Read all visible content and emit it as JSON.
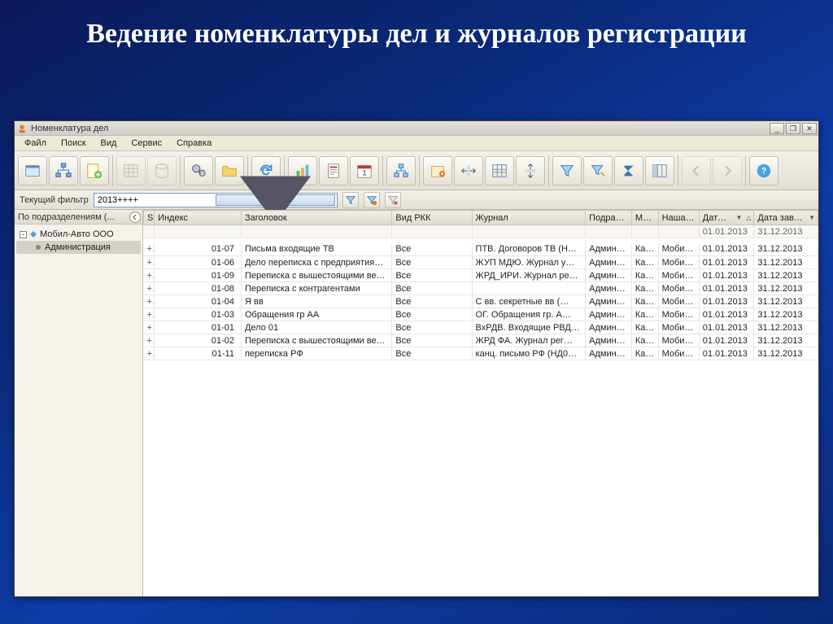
{
  "slide": {
    "title": "Ведение номенклатуры дел и журналов регистрации"
  },
  "window": {
    "title": "Номенклатура дел",
    "btn_min": "_",
    "btn_max": "❐",
    "btn_close": "✕"
  },
  "menu": {
    "file": "Файл",
    "search": "Поиск",
    "view": "Вид",
    "service": "Сервис",
    "help": "Справка"
  },
  "filter": {
    "label": "Текущий фильтр",
    "value": "2013++++"
  },
  "sidebar": {
    "header": "По подразделениям (...",
    "root": "Мобил-Авто ООО",
    "child": "Администрация"
  },
  "columns": {
    "s": "S",
    "index": "Индекс",
    "title": "Заголовок",
    "rkk": "Вид РКК",
    "journal": "Журнал",
    "dept": "Подразде…",
    "me": "Ме…",
    "our": "Наша …",
    "dat": "Дат…",
    "sort": "△",
    "dd": "▼",
    "end": "Дата зав…"
  },
  "summary": {
    "dat": "01.01.2013",
    "end": "31.12.2013"
  },
  "rows": [
    {
      "p": "+",
      "idx": "01-07",
      "title": "Письма входящие ТВ",
      "rkk": "Все",
      "journal": "ПТВ. Договоров ТВ (Н…",
      "dept": "Админист…",
      "me": "Ка…",
      "our": "Мобил…",
      "dat": "01.01.2013",
      "end": "31.12.2013"
    },
    {
      "p": "+",
      "idx": "01-06",
      "title": "Дело переписка с предприятиями М…",
      "rkk": "Все",
      "journal": "ЖУП МДЮ. Журнал у…",
      "dept": "Админист…",
      "me": "Ка…",
      "our": "Мобил…",
      "dat": "01.01.2013",
      "end": "31.12.2013"
    },
    {
      "p": "+",
      "idx": "01-09",
      "title": "Переписка с вышестоящими ведомс…",
      "rkk": "Все",
      "journal": "ЖРД_ИРИ. Журнал ре…",
      "dept": "Админист…",
      "me": "Ка…",
      "our": "Мобил…",
      "dat": "01.01.2013",
      "end": "31.12.2013"
    },
    {
      "p": "+",
      "idx": "01-08",
      "title": "Переписка с контрагентами",
      "rkk": "Все",
      "journal": "",
      "dept": "Админист…",
      "me": "Ка…",
      "our": "Мобил…",
      "dat": "01.01.2013",
      "end": "31.12.2013"
    },
    {
      "p": "+",
      "idx": "01-04",
      "title": "Я вв",
      "rkk": "Все",
      "journal": "С вв. секретные вв (…",
      "dept": "Админист…",
      "me": "Ка…",
      "our": "Мобил…",
      "dat": "01.01.2013",
      "end": "31.12.2013"
    },
    {
      "p": "+",
      "idx": "01-03",
      "title": "Обращения гр АА",
      "rkk": "Все",
      "journal": "ОГ. Обращения гр. А…",
      "dept": "Админист…",
      "me": "Ка…",
      "our": "Мобил…",
      "dat": "01.01.2013",
      "end": "31.12.2013"
    },
    {
      "p": "+",
      "idx": "01-01",
      "title": "Дело 01",
      "rkk": "Все",
      "journal": "ВхРДВ. Входящие РВД…",
      "dept": "Админист…",
      "me": "Ка…",
      "our": "Мобил…",
      "dat": "01.01.2013",
      "end": "31.12.2013"
    },
    {
      "p": "+",
      "idx": "01-02",
      "title": "Переписка с вышестоящими ведомс…",
      "rkk": "Все",
      "journal": "ЖРД ФА. Журнал рег…",
      "dept": "Админист…",
      "me": "Ка…",
      "our": "Мобил…",
      "dat": "01.01.2013",
      "end": "31.12.2013"
    },
    {
      "p": "+",
      "idx": "01-11",
      "title": "переписка РФ",
      "rkk": "Все",
      "journal": "канц. письмо РФ (НД0…",
      "dept": "Админист…",
      "me": "Ка…",
      "our": "Мобил…",
      "dat": "01.01.2013",
      "end": "31.12.2013"
    }
  ]
}
